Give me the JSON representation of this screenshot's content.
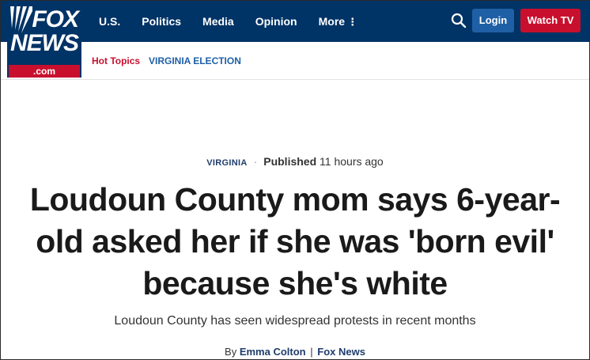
{
  "logo": {
    "line1": "FOX",
    "line2": "NEWS",
    "domain": ".com"
  },
  "nav": {
    "items": [
      {
        "label": "U.S."
      },
      {
        "label": "Politics"
      },
      {
        "label": "Media"
      },
      {
        "label": "Opinion"
      },
      {
        "label": "More"
      }
    ],
    "more_icon": "⋮",
    "login_label": "Login",
    "watch_label": "Watch TV",
    "search_icon": "search-icon"
  },
  "subnav": {
    "hot_topics": "Hot Topics",
    "topic": "VIRGINIA ELECTION"
  },
  "article": {
    "category": "VIRGINIA",
    "separator": "·",
    "published_label": "Published",
    "published_time": "11 hours ago",
    "headline": "Loudoun County mom says 6-year-old asked her if she was 'born evil' because she's white",
    "subhead": "Loudoun County has seen widespread protests in recent months",
    "byline_prefix": "By",
    "author": "Emma Colton",
    "byline_sep": "|",
    "outlet": "Fox News"
  },
  "colors": {
    "header_bg": "#003366",
    "brand_red": "#c8102e",
    "login_blue": "#1f5fa5"
  }
}
